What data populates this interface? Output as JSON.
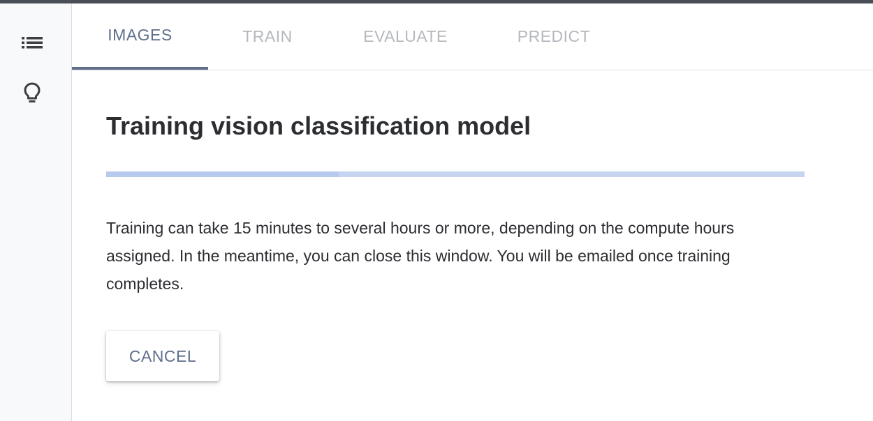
{
  "sidebar": {
    "icons": [
      {
        "name": "list-icon"
      },
      {
        "name": "lightbulb-icon"
      }
    ]
  },
  "tabs": [
    {
      "label": "IMAGES",
      "active": true
    },
    {
      "label": "TRAIN",
      "active": false
    },
    {
      "label": "EVALUATE",
      "active": false
    },
    {
      "label": "PREDICT",
      "active": false
    }
  ],
  "main": {
    "title": "Training vision classification model",
    "progress": {
      "indeterminate": true
    },
    "description": "Training can take 15 minutes to several hours or more, depending on the compute hours assigned. In the meantime, you can close this window. You will be emailed once training completes.",
    "cancel_label": "CANCEL"
  },
  "colors": {
    "accent": "#5f6f8c",
    "inactive_tab": "#b5b8bd",
    "progress_track": "#c6d4ef",
    "text": "#2b2d31"
  }
}
